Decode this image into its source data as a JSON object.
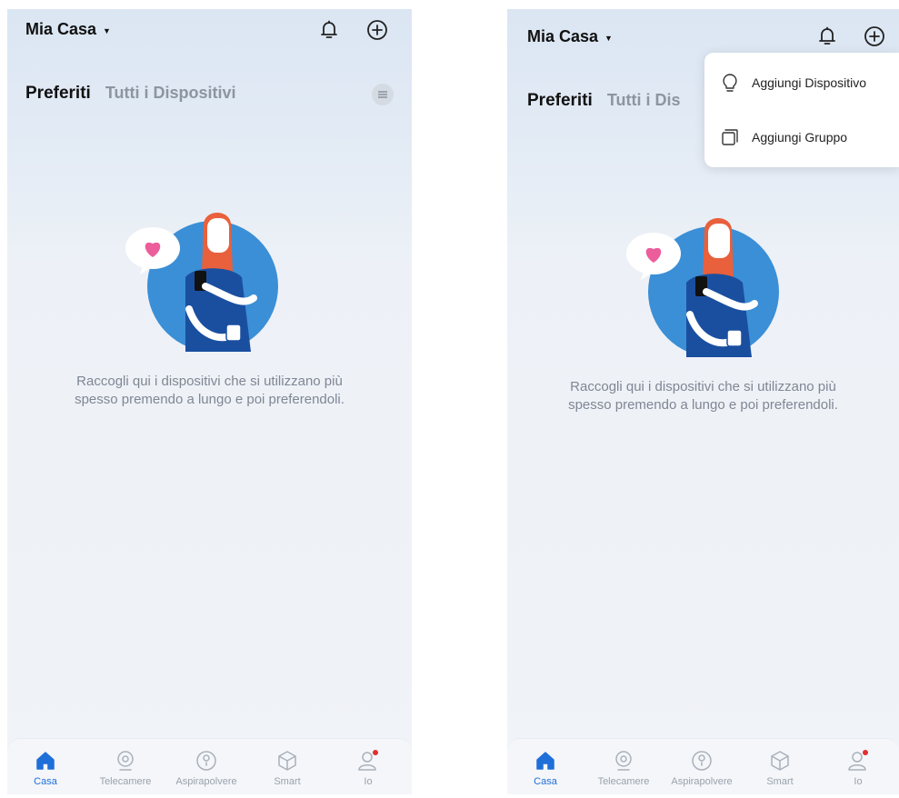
{
  "screens": [
    {
      "home_name": "Mia Casa",
      "tab_favorites": "Preferiti",
      "tab_all_devices": "Tutti i Dispositivi",
      "empty_message_line1": "Raccogli qui i dispositivi che si utilizzano più",
      "empty_message_line2": "spesso  premendo a lungo e poi preferendoli.",
      "nav": [
        {
          "label": "Casa",
          "icon": "home-icon",
          "active": true
        },
        {
          "label": "Telecamere",
          "icon": "camera-icon",
          "active": false
        },
        {
          "label": "Aspirapolvere",
          "icon": "vacuum-icon",
          "active": false
        },
        {
          "label": "Smart",
          "icon": "cube-icon",
          "active": false
        },
        {
          "label": "Io",
          "icon": "profile-icon",
          "active": false
        }
      ]
    },
    {
      "home_name": "Mia Casa",
      "tab_favorites": "Preferiti",
      "tab_all_devices": "Tutti i Dis",
      "empty_message_line1": "Raccogli qui i dispositivi che si utilizzano più",
      "empty_message_line2": "spesso  premendo a lungo e poi preferendoli.",
      "add_menu": {
        "items": [
          {
            "label": "Aggiungi Dispositivo",
            "icon": "bulb-icon"
          },
          {
            "label": "Aggiungi Gruppo",
            "icon": "group-icon"
          }
        ]
      },
      "nav": [
        {
          "label": "Casa",
          "icon": "home-icon",
          "active": true
        },
        {
          "label": "Telecamere",
          "icon": "camera-icon",
          "active": false
        },
        {
          "label": "Aspirapolvere",
          "icon": "vacuum-icon",
          "active": false
        },
        {
          "label": "Smart",
          "icon": "cube-icon",
          "active": false
        },
        {
          "label": "Io",
          "icon": "profile-icon",
          "active": false
        }
      ]
    }
  ],
  "colors": {
    "accent": "#1f6fd9",
    "heart": "#ec5d9b",
    "notification_dot": "#e0302f",
    "illustration_circle": "#3b8fd6"
  }
}
